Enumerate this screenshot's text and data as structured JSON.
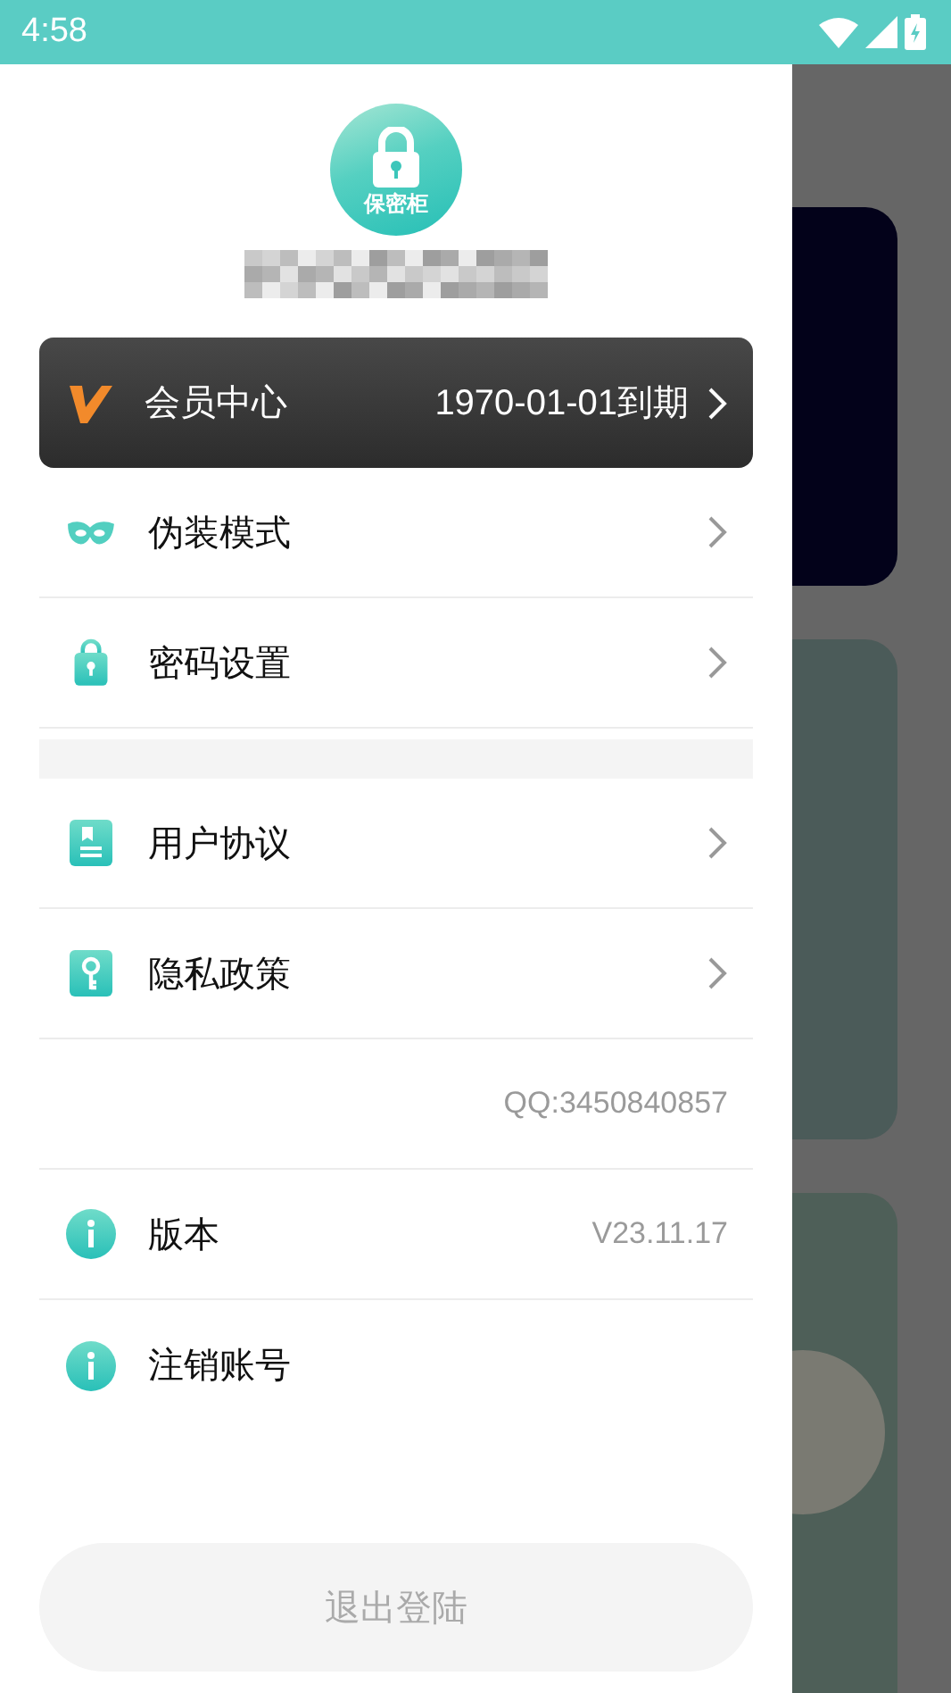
{
  "status_bar": {
    "time": "4:58"
  },
  "drawer": {
    "logo_text": "保密柜",
    "vip": {
      "label": "会员中心",
      "value": "1970-01-01到期"
    },
    "groups": [
      {
        "items": [
          {
            "kind": "nav",
            "label": "伪装模式"
          },
          {
            "kind": "nav",
            "label": "密码设置"
          }
        ]
      },
      {
        "items": [
          {
            "kind": "nav",
            "label": "用户协议"
          },
          {
            "kind": "nav",
            "label": "隐私政策"
          },
          {
            "kind": "note",
            "value": "QQ:3450840857"
          },
          {
            "kind": "info",
            "label": "版本",
            "value": "V23.11.17"
          },
          {
            "kind": "info",
            "label": "注销账号"
          }
        ]
      }
    ],
    "logout_button": "退出登陆"
  }
}
